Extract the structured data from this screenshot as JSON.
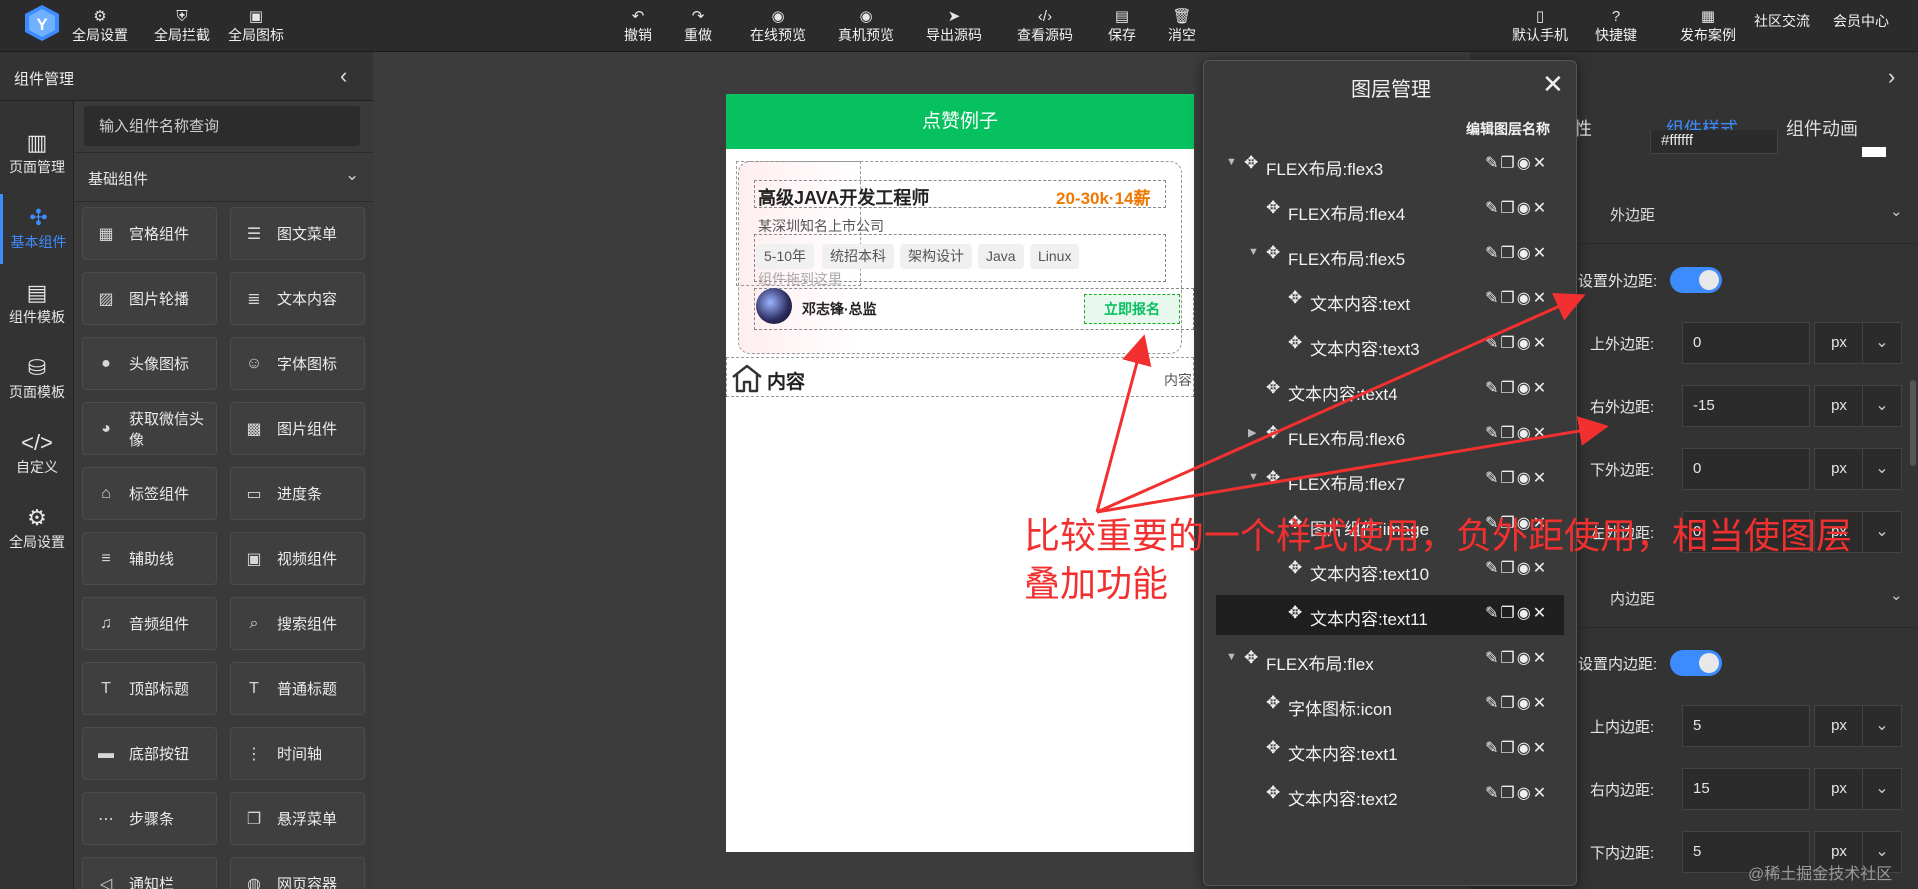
{
  "topbar": {
    "left": [
      {
        "icon": "sliders-icon",
        "label": "全局设置"
      },
      {
        "icon": "shield-icon",
        "label": "全局拦截"
      },
      {
        "icon": "ab-icon",
        "label": "全局图标"
      }
    ],
    "center": [
      {
        "icon": "undo-icon",
        "label": "撤销"
      },
      {
        "icon": "redo-icon",
        "label": "重做"
      },
      {
        "icon": "eye-icon",
        "label": "在线预览"
      },
      {
        "icon": "eye-icon",
        "label": "真机预览"
      },
      {
        "icon": "send-icon",
        "label": "导出源码"
      },
      {
        "icon": "code-icon",
        "label": "查看源码"
      },
      {
        "icon": "save-icon",
        "label": "保存"
      },
      {
        "icon": "trash-icon",
        "label": "消空"
      }
    ],
    "right": [
      {
        "icon": "phone-icon",
        "label": "默认手机"
      },
      {
        "icon": "help-icon",
        "label": "快捷键"
      },
      {
        "icon": "publish-icon",
        "label": "发布案例"
      }
    ],
    "links": [
      "社区交流",
      "会员中心"
    ]
  },
  "left_panel": {
    "title": "组件管理",
    "rail": [
      {
        "icon": "page-icon",
        "label": "页面管理"
      },
      {
        "icon": "puzzle-icon",
        "label": "基本组件",
        "active": true
      },
      {
        "icon": "template-icon",
        "label": "组件模板"
      },
      {
        "icon": "database-icon",
        "label": "页面模板"
      },
      {
        "icon": "custom-code-icon",
        "label": "自定义"
      },
      {
        "icon": "gear-icon",
        "label": "全局设置"
      }
    ],
    "search_placeholder": "输入组件名称查询",
    "section": "基础组件",
    "components": [
      {
        "icon": "grid-icon",
        "label": "宫格组件"
      },
      {
        "icon": "list-icon",
        "label": "图文菜单"
      },
      {
        "icon": "image-icon",
        "label": "图片轮播"
      },
      {
        "icon": "text-icon",
        "label": "文本内容"
      },
      {
        "icon": "avatar-icon",
        "label": "头像图标"
      },
      {
        "icon": "smile-icon",
        "label": "字体图标"
      },
      {
        "icon": "wechat-avatar-icon",
        "label": "获取微信头像"
      },
      {
        "icon": "picture-icon",
        "label": "图片组件"
      },
      {
        "icon": "tag-icon",
        "label": "标签组件"
      },
      {
        "icon": "progress-icon",
        "label": "进度条"
      },
      {
        "icon": "line-icon",
        "label": "辅助线"
      },
      {
        "icon": "video-icon",
        "label": "视频组件"
      },
      {
        "icon": "music-icon",
        "label": "音频组件"
      },
      {
        "icon": "search-icon",
        "label": "搜索组件"
      },
      {
        "icon": "title-icon",
        "label": "顶部标题"
      },
      {
        "icon": "title-icon",
        "label": "普通标题"
      },
      {
        "icon": "button-icon",
        "label": "底部按钮"
      },
      {
        "icon": "timeline-icon",
        "label": "时间轴"
      },
      {
        "icon": "steps-icon",
        "label": "步骤条"
      },
      {
        "icon": "float-menu-icon",
        "label": "悬浮菜单"
      },
      {
        "icon": "notice-icon",
        "label": "通知栏"
      },
      {
        "icon": "globe-icon",
        "label": "网页容器"
      }
    ]
  },
  "phone": {
    "header": "点赞例子",
    "job_title": "高级JAVA开发工程师",
    "salary": "20-30k·14薪",
    "company": "某深圳知名上市公司",
    "tags": [
      "5-10年",
      "统招本科",
      "架构设计",
      "Java",
      "Linux"
    ],
    "drag_tip": "组件拖到这里",
    "author": "邓志锋·总监",
    "apply": "立即报名",
    "row2_title": "内容",
    "row2_right": "内容"
  },
  "layer_panel": {
    "title": "图层管理",
    "edit_label": "编辑图层名称",
    "items": [
      {
        "name": "FLEX布局:flex3",
        "level": 0,
        "toggle": "down"
      },
      {
        "name": "FLEX布局:flex4",
        "level": 1,
        "toggle": ""
      },
      {
        "name": "FLEX布局:flex5",
        "level": 1,
        "toggle": "down"
      },
      {
        "name": "文本内容:text",
        "level": 2,
        "toggle": ""
      },
      {
        "name": "文本内容:text3",
        "level": 2,
        "toggle": ""
      },
      {
        "name": "文本内容:text4",
        "level": 1,
        "toggle": ""
      },
      {
        "name": "FLEX布局:flex6",
        "level": 1,
        "toggle": "right"
      },
      {
        "name": "FLEX布局:flex7",
        "level": 1,
        "toggle": "down"
      },
      {
        "name": "图片组件:image",
        "level": 2,
        "toggle": ""
      },
      {
        "name": "文本内容:text10",
        "level": 2,
        "toggle": ""
      },
      {
        "name": "文本内容:text11",
        "level": 2,
        "toggle": "",
        "selected": true
      },
      {
        "name": "FLEX布局:flex",
        "level": 0,
        "toggle": "down"
      },
      {
        "name": "字体图标:icon",
        "level": 1,
        "toggle": ""
      },
      {
        "name": "文本内容:text1",
        "level": 1,
        "toggle": ""
      },
      {
        "name": "文本内容:text2",
        "level": 1,
        "toggle": ""
      }
    ]
  },
  "right_panel": {
    "tabs": [
      "组件属性",
      "组件样式",
      "组件动画"
    ],
    "active_tab": "组件样式",
    "top_value": "#ffffff",
    "margin_section": "外边距",
    "margin_toggle_label": "设置外边距:",
    "margin_fields": [
      {
        "label": "上外边距:",
        "value": "0",
        "unit": "px"
      },
      {
        "label": "右外边距:",
        "value": "-15",
        "unit": "px"
      },
      {
        "label": "下外边距:",
        "value": "0",
        "unit": "px"
      },
      {
        "label": "左外边距:",
        "value": "0",
        "unit": "px"
      }
    ],
    "padding_section": "内边距",
    "padding_toggle_label": "设置内边距:",
    "padding_fields": [
      {
        "label": "上内边距:",
        "value": "5",
        "unit": "px"
      },
      {
        "label": "右内边距:",
        "value": "15",
        "unit": "px"
      },
      {
        "label": "下内边距:",
        "value": "5",
        "unit": "px"
      }
    ]
  },
  "annotation": {
    "line1": "比较重要的一个样式使用，负外距使用，相当使图层",
    "line2": "叠加功能",
    "color": "#f23030"
  },
  "watermark": "@稀土掘金技术社区"
}
